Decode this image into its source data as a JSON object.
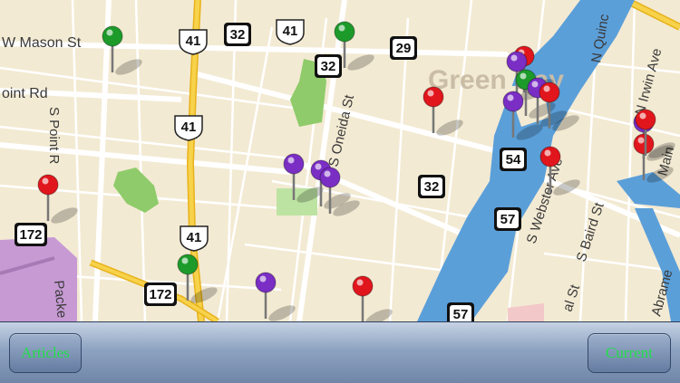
{
  "map": {
    "city_label": "Green Bay",
    "streets": {
      "w_mason": "W Mason St",
      "point_rd": "oint Rd",
      "s_point": "S Point R",
      "s_oneida": "S Oneida St",
      "s_webster": "S Webster Ave",
      "s_baird": "S Baird St",
      "n_quinc": "N Quinc",
      "n_irwin": "N Irwin Ave",
      "main": "Main",
      "packe": "Packe",
      "abrame": "Abrame",
      "al_st": "al St"
    },
    "shields": [
      {
        "type": "us",
        "num": "41"
      },
      {
        "type": "state",
        "num": "32"
      },
      {
        "type": "us",
        "num": "41"
      },
      {
        "type": "state",
        "num": "32"
      },
      {
        "type": "state",
        "num": "29"
      },
      {
        "type": "us",
        "num": "41"
      },
      {
        "type": "state",
        "num": "54"
      },
      {
        "type": "state",
        "num": "32"
      },
      {
        "type": "state",
        "num": "57"
      },
      {
        "type": "state",
        "num": "172"
      },
      {
        "type": "us",
        "num": "41"
      },
      {
        "type": "state",
        "num": "172"
      },
      {
        "type": "state",
        "num": "57"
      }
    ],
    "pin_colors": {
      "red": "#e0161c",
      "green": "#1c9a2a",
      "purple": "#7a2ec4"
    },
    "pins": [
      "green",
      "green",
      "red",
      "red",
      "purple",
      "green",
      "purple",
      "purple",
      "red",
      "purple",
      "red",
      "purple",
      "purple",
      "purple",
      "red",
      "red",
      "red",
      "purple",
      "green",
      "red"
    ]
  },
  "toolbar": {
    "articles_label": "Articles",
    "current_label": "Current",
    "label_color": "#21e04a"
  }
}
